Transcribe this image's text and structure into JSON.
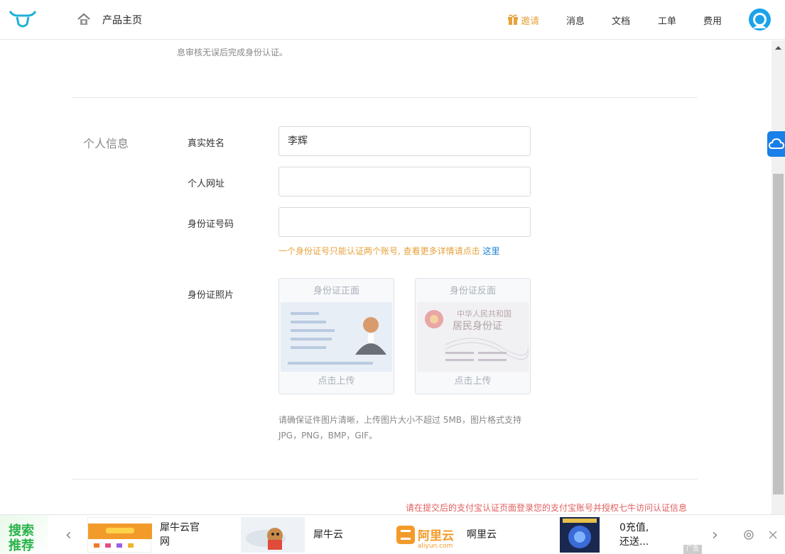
{
  "header": {
    "home_title": "产品主页",
    "nav": [
      {
        "label": "邀请"
      },
      {
        "label": "消息"
      },
      {
        "label": "文档"
      },
      {
        "label": "工单"
      },
      {
        "label": "费用"
      }
    ]
  },
  "content": {
    "prev_note": "息审核无误后完成身份认证。",
    "section_title": "个人信息",
    "fields": {
      "name": {
        "label": "真实姓名",
        "value": "李辉"
      },
      "website": {
        "label": "个人网址",
        "value": ""
      },
      "id_number": {
        "label": "身份证号码",
        "value": ""
      }
    },
    "hint": "一个身份证号只能认证两个账号, 查看更多详情请点击 ",
    "hint_link": "这里",
    "photo_label": "身份证照片",
    "front_card": {
      "title": "身份证正面",
      "action": "点击上传"
    },
    "back_card": {
      "title": "身份证反面",
      "action": "点击上传",
      "emblem_text1": "中华人民共和国",
      "emblem_text2": "居民身份证"
    },
    "desc_line1": "请确保证件图片清晰，上传图片大小不超过 5MB，图片格式支持",
    "desc_line2": "JPG，PNG，BMP，GIF。",
    "auth_note": "请在提交后的支付宝认证页面登录您的支付宝账号并授权七牛访问认证信息"
  },
  "adbar": {
    "tag_line1": "搜索",
    "tag_line2": "推荐",
    "items": [
      {
        "line1": "犀牛云官",
        "line2": "网"
      },
      {
        "line1": "犀牛云",
        "line2": ""
      },
      {
        "line1": "啊里云",
        "line2": "",
        "logo_text": "阿里云",
        "logo_sub": "aliyun.com"
      },
      {
        "line1": "0充值,",
        "line2": "还送..."
      }
    ],
    "ad_label": "广告"
  },
  "colors": {
    "accent": "#1a7fd6",
    "invite": "#e6a23c",
    "warning": "#e06060",
    "ad_green": "#29b34a"
  }
}
